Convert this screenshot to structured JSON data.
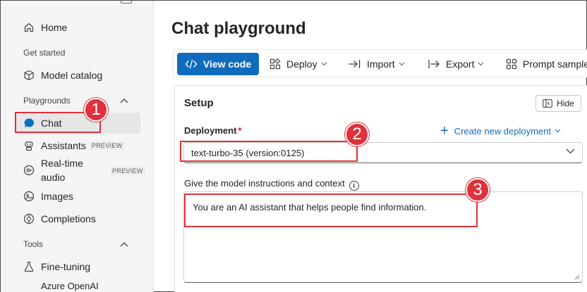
{
  "sidebar": {
    "home": "Home",
    "get_started": "Get started",
    "model_catalog": "Model catalog",
    "playgrounds": "Playgrounds",
    "chat": "Chat",
    "assistants": "Assistants",
    "assistants_badge": "PREVIEW",
    "realtime_line1": "Real-time",
    "realtime_line2": "audio",
    "realtime_badge": "PREVIEW",
    "images": "Images",
    "completions": "Completions",
    "tools": "Tools",
    "fine_tuning": "Fine-tuning",
    "azure_openai": "Azure OpenAI"
  },
  "main": {
    "title": "Chat playground",
    "toolbar": {
      "view_code": "View code",
      "deploy": "Deploy",
      "import": "Import",
      "export": "Export",
      "prompt_samples": "Prompt samples"
    },
    "setup": {
      "title": "Setup",
      "hide": "Hide",
      "deployment_label": "Deployment",
      "required_mark": "*",
      "create_new_deployment": "Create new deployment",
      "deployment_value": "text-turbo-35 (version:0125)",
      "instructions_label": "Give the model instructions and context",
      "instructions_value": "You are an AI assistant that helps people find information."
    }
  },
  "callouts": [
    "1",
    "2",
    "3"
  ],
  "colors": {
    "accent": "#0f6cbd",
    "callout": "#e0303b",
    "required": "#c50f1f"
  }
}
